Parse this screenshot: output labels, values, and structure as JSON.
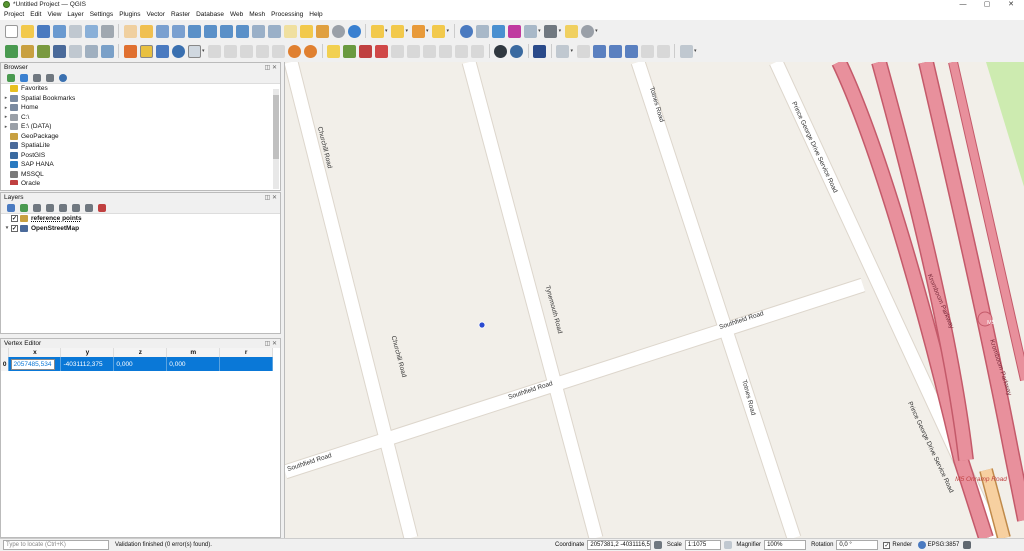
{
  "window": {
    "title": "*Untitled Project — QGIS",
    "minimize": "—",
    "maximize": "▢",
    "close": "✕"
  },
  "menu": [
    "Project",
    "Edit",
    "View",
    "Layer",
    "Settings",
    "Plugins",
    "Vector",
    "Raster",
    "Database",
    "Web",
    "Mesh",
    "Processing",
    "Help"
  ],
  "browser": {
    "title": "Browser",
    "items": [
      {
        "label": "Favorites",
        "expand": "",
        "icon": "star-icon",
        "color": "#e8c020"
      },
      {
        "label": "Spatial Bookmarks",
        "expand": "▸",
        "icon": "bookmark-icon",
        "color": "#7a8aa0"
      },
      {
        "label": "Home",
        "expand": "▸",
        "icon": "home-folder-icon",
        "color": "#7a8aa0"
      },
      {
        "label": "C:\\",
        "expand": "▸",
        "icon": "drive-icon",
        "color": "#9aa0a8"
      },
      {
        "label": "E:\\ (DATA)",
        "expand": "▸",
        "icon": "drive-icon",
        "color": "#9aa0a8"
      },
      {
        "label": "GeoPackage",
        "expand": "",
        "icon": "geopackage-icon",
        "color": "#c8a040"
      },
      {
        "label": "SpatiaLite",
        "expand": "",
        "icon": "spatialite-icon",
        "color": "#4a6a9a"
      },
      {
        "label": "PostGIS",
        "expand": "",
        "icon": "postgis-icon",
        "color": "#3a6aa0"
      },
      {
        "label": "SAP HANA",
        "expand": "",
        "icon": "sap-hana-icon",
        "color": "#2a7ac0"
      },
      {
        "label": "MSSQL",
        "expand": "",
        "icon": "mssql-icon",
        "color": "#7a7a7a"
      },
      {
        "label": "Oracle",
        "expand": "",
        "icon": "oracle-icon",
        "color": "#c04040"
      }
    ]
  },
  "layers": {
    "title": "Layers",
    "items": [
      {
        "label": "reference points",
        "checked": "✓",
        "icon": "pen-edit-icon",
        "color": "#c8a040"
      },
      {
        "label": "OpenStreetMap",
        "checked": "✓",
        "icon": "xyz-tiles-icon",
        "color": "#4a6a9a"
      }
    ]
  },
  "vertex_editor": {
    "title": "Vertex Editor",
    "columns": [
      "x",
      "y",
      "z",
      "m",
      "r"
    ],
    "row": {
      "index": "0",
      "x": "2057485,534",
      "y": "-4031112,375",
      "z": "0,000",
      "m": "0,000",
      "r": ""
    }
  },
  "map": {
    "roads": [
      "Churchill Road",
      "Tynemouth Road",
      "Totnes Road",
      "Prince George Drive Service Road",
      "Southfield Road",
      "Southfield Road",
      "Southfield Road",
      "Churchill Road",
      "Totnes Road",
      "Prince George Drive Service Road",
      "Kromboom Parkway",
      "Kromboom Parkway",
      "M5",
      "M5 Onramp Road"
    ]
  },
  "status": {
    "locate_placeholder": "Type to locate (Ctrl+K)",
    "message": "Validation finished (0 error(s) found).",
    "coordinate_label": "Coordinate",
    "coordinate": "2057381,2 -4031116,5",
    "scale_label": "Scale",
    "scale": "1:1075",
    "magnifier_label": "Magnifier",
    "magnifier": "100%",
    "rotation_label": "Rotation",
    "rotation": "0,0 °",
    "render_label": "Render",
    "render_check": "✓",
    "crs": "EPSG:3857"
  },
  "colors": {
    "accent": "#0a78d7",
    "motorway": "#e8909c",
    "land": "#f2efe9",
    "road": "#ffffff",
    "grass": "#cdebb0"
  }
}
